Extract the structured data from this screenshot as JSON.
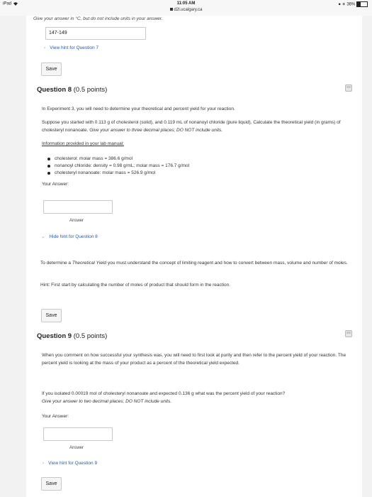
{
  "status_bar": {
    "device": "iPad",
    "wifi_icon": "wifi-icon",
    "time": "11:05 AM",
    "url": "d2l.ucalgary.ca",
    "battery": "36%",
    "battery_level": 0.36
  },
  "q7": {
    "instruction": "Give your answer in °C, but do not include units in your answer.",
    "answer_value": "147-149",
    "hint_link": "View hint for Question 7",
    "save_label": "Save"
  },
  "q8": {
    "title_bold": "Question 8",
    "points": "(0.5 points)",
    "intro": "In Experiment 3, you will need to determine your theoretical and percent yield for your reaction.",
    "problem_plain": "Suppose you started with 0.113 g of cholesterol (solid), and 0.119 mL of nonanoyl chloride (pure liquid). Calculate the theoretical yield (in grams) of cholesteryl nonanoate.",
    "problem_italic": "Give your answer to three decimal places; DO NOT include units.",
    "info_heading": "Information provided in your lab manual:",
    "bullets": [
      "cholesterol: molar mass = 386.6 g/mol",
      "nonanoyl chloride: density = 0.98 g/mL; molar mass = 176.7 g/mol",
      "cholesteryl nonanoate: molar mass = 526.9 g/mol"
    ],
    "your_answer_label": "Your Answer:",
    "answer_value": "",
    "answer_caption": "Answer",
    "hint_link": "Hide hint for Question 8",
    "hint_text_1_pre": "To determine a",
    "hint_text_1_italic": "Theoretical Yield",
    "hint_text_1_post": "you must understand the concept of limiting reagent and how to convert between mass, volume and number of moles.",
    "hint_text_2": "Hint: First start by calculating the number of moles of product that should form in the reaction.",
    "save_label": "Save"
  },
  "q9": {
    "title_bold": "Question 9",
    "points": "(0.5 points)",
    "intro": "When you comment on how successful your synthesis was, you will need to first look at purity and then refer to the percent yield of your reaction. The percent yield  is looking at the mass of your product as a percent of the theoretical yield expected.",
    "problem_plain": "If you isolated 0.00019 mol of cholesteryl nonanoate and expected 0.136 g what was the percent yield of your reaction?",
    "problem_italic": "Give your answer to two decimal places; DO NOT include units.",
    "your_answer_label": "Your Answer:",
    "answer_value": "",
    "answer_caption": "Answer",
    "hint_link": "View hint for Question 9",
    "save_label": "Save"
  }
}
